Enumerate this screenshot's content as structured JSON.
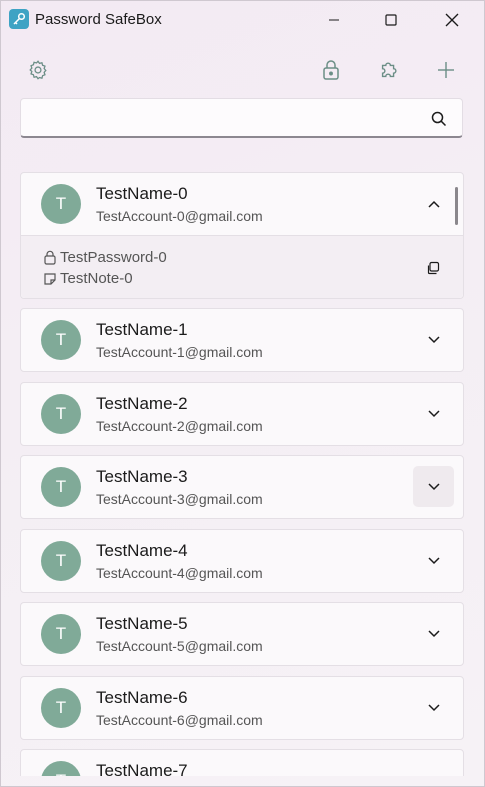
{
  "window": {
    "title": "Password SafeBox",
    "controls": [
      "minimize",
      "maximize",
      "close"
    ]
  },
  "toolbar": {
    "icons": [
      "gear-icon",
      "lock-icon",
      "puzzle-icon",
      "plus-icon"
    ]
  },
  "search": {
    "value": "",
    "placeholder": ""
  },
  "accounts": [
    {
      "initial": "T",
      "name": "TestName-0",
      "account": "TestAccount-0@gmail.com",
      "expanded": true,
      "password": "TestPassword-0",
      "note": "TestNote-0"
    },
    {
      "initial": "T",
      "name": "TestName-1",
      "account": "TestAccount-1@gmail.com",
      "expanded": false
    },
    {
      "initial": "T",
      "name": "TestName-2",
      "account": "TestAccount-2@gmail.com",
      "expanded": false
    },
    {
      "initial": "T",
      "name": "TestName-3",
      "account": "TestAccount-3@gmail.com",
      "expanded": false
    },
    {
      "initial": "T",
      "name": "TestName-4",
      "account": "TestAccount-4@gmail.com",
      "expanded": false
    },
    {
      "initial": "T",
      "name": "TestName-5",
      "account": "TestAccount-5@gmail.com",
      "expanded": false
    },
    {
      "initial": "T",
      "name": "TestName-6",
      "account": "TestAccount-6@gmail.com",
      "expanded": false
    },
    {
      "initial": "T",
      "name": "TestName-7",
      "account": "",
      "expanded": false
    }
  ],
  "colors": {
    "avatar": "#80aa98",
    "app_icon": "#3ea3c4",
    "accent": "#8c8790"
  }
}
